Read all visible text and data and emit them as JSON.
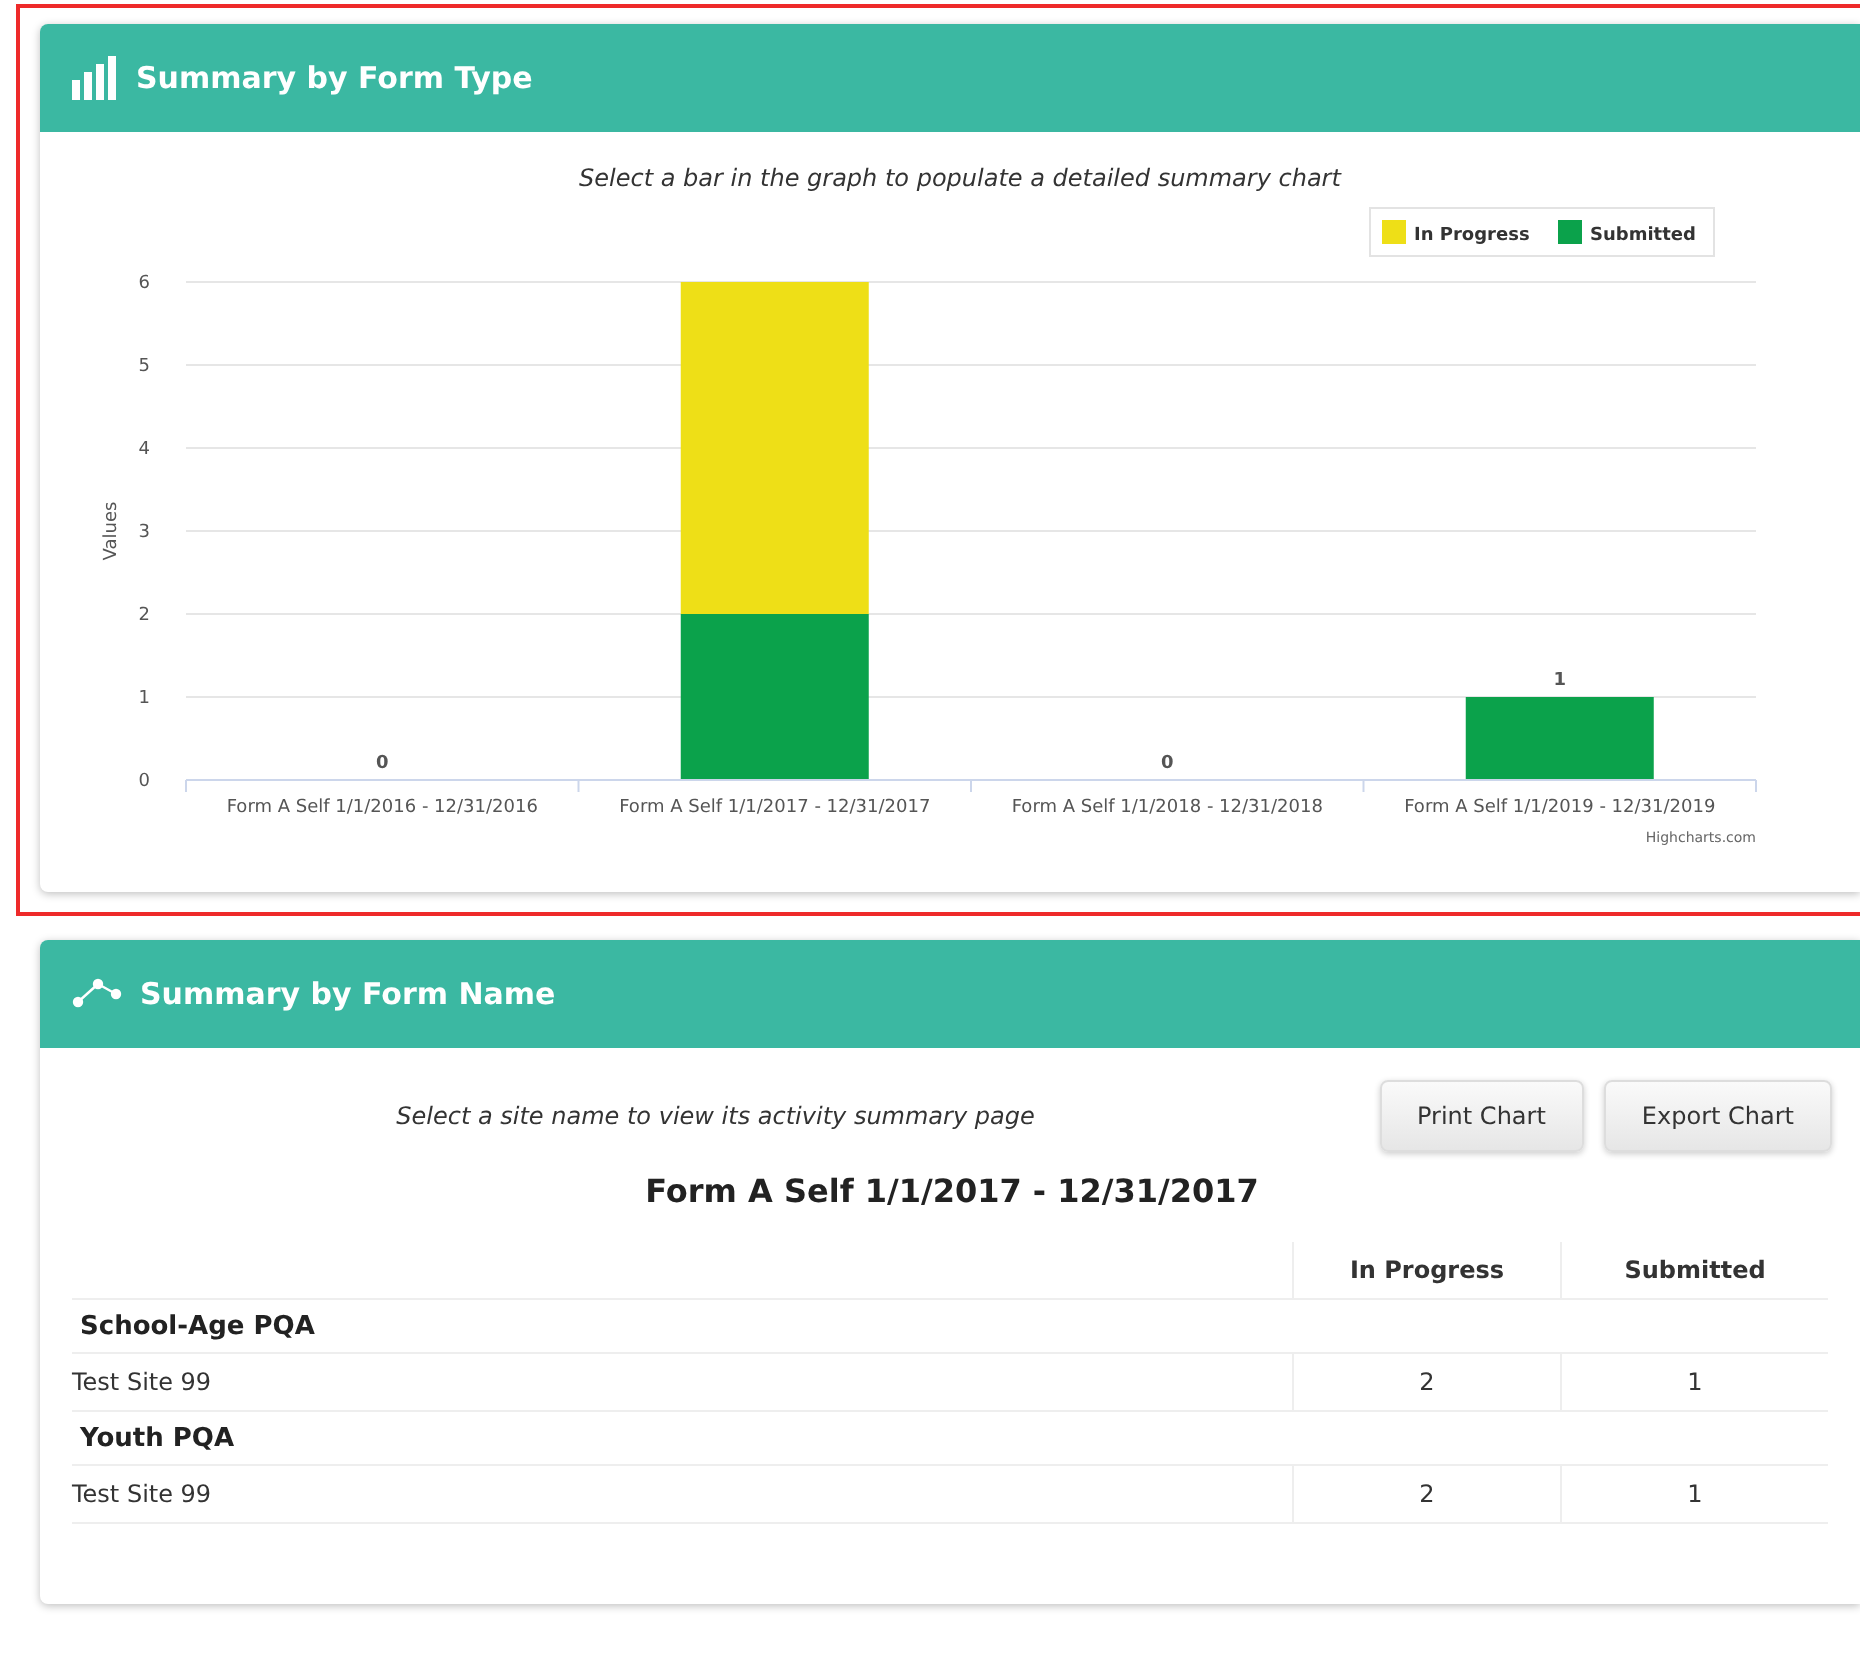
{
  "panels": [
    {
      "kind": "chart",
      "title": "Summary by Form Type",
      "highlighted": true,
      "hint": "Select a bar in the graph to populate a detailed summary chart",
      "credit": "Highcharts.com",
      "chart_data": {
        "type": "bar",
        "ylabel": "Values",
        "categories": [
          "Form A Self 1/1/2016 - 12/31/2016",
          "Form A Self 1/1/2017 - 12/31/2017",
          "Form A Self 1/1/2018 - 12/31/2018",
          "Form A Self 1/1/2019 - 12/31/2019"
        ],
        "stacked": true,
        "grid": true,
        "legend": true,
        "ylim": [
          0,
          6
        ],
        "yticks": [
          0,
          1,
          2,
          3,
          4,
          5,
          6
        ],
        "value_labels": [
          "0",
          null,
          "0",
          "1"
        ],
        "series": [
          {
            "name": "In Progress",
            "color": "#eedf17",
            "values": [
              0,
              4,
              0,
              0
            ]
          },
          {
            "name": "Submitted",
            "color": "#0ba24b",
            "values": [
              0,
              2,
              0,
              1
            ]
          }
        ]
      }
    },
    {
      "kind": "table",
      "title": "Summary by Form Name",
      "highlighted": false,
      "hint": "Select a site name to view its activity summary page",
      "buttons": [
        "Print Chart",
        "Export Chart"
      ],
      "heading": "Form A Self 1/1/2017 - 12/31/2017",
      "table": {
        "columns": [
          "In Progress",
          "Submitted"
        ],
        "groups": [
          {
            "name": "School-Age PQA",
            "rows": [
              {
                "site": "Test Site 99",
                "cells": [
                  "2",
                  "1"
                ]
              }
            ]
          },
          {
            "name": "Youth PQA",
            "rows": [
              {
                "site": "Test Site 99",
                "cells": [
                  "2",
                  "1"
                ]
              }
            ]
          }
        ]
      }
    }
  ]
}
